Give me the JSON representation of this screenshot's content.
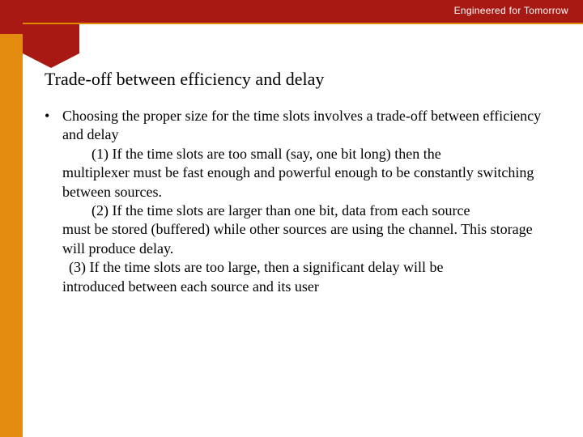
{
  "header": {
    "tagline": "Engineered for Tomorrow"
  },
  "slide": {
    "title": "Trade-off between efficiency and delay"
  },
  "content": {
    "bullet_mark": "•",
    "lead": "Choosing the proper size for the time slots involves a trade-off between efficiency and delay",
    "p1a": "(1) If the time slots are too small (say, one bit long) then the",
    "p1b": "multiplexer must be fast enough and powerful enough to be constantly switching between sources.",
    "p2a": "(2) If the time slots are larger than one bit, data from each source",
    "p2b": "must be stored (buffered) while other sources are using the channel. This storage will produce delay.",
    "p3a": "(3) If the time slots are too large, then a significant delay will be",
    "p3b": "introduced between each source and its user"
  }
}
